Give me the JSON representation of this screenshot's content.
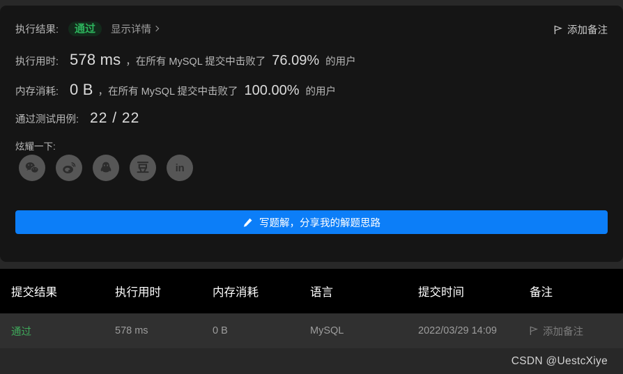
{
  "result_panel": {
    "result_row": {
      "label": "执行结果:",
      "status": "通过",
      "detail_link": "显示详情"
    },
    "add_note_top": {
      "label": "添加备注",
      "icon": "flag-icon"
    },
    "runtime_row": {
      "label": "执行用时:",
      "value": "578 ms",
      "middle": "，在所有 MySQL 提交中击败了",
      "percent": "76.09%",
      "tail": "的用户"
    },
    "memory_row": {
      "label": "内存消耗:",
      "value": "0 B",
      "middle": "，在所有 MySQL 提交中击败了",
      "percent": "100.00%",
      "tail": "的用户"
    },
    "testcases_row": {
      "label": "通过测试用例:",
      "value": "22 / 22"
    },
    "share": {
      "label": "炫耀一下:",
      "icons": [
        {
          "name": "wechat-icon",
          "glyph": ""
        },
        {
          "name": "weibo-icon",
          "glyph": ""
        },
        {
          "name": "qq-icon",
          "glyph": ""
        },
        {
          "name": "douban-icon",
          "glyph": "豆"
        },
        {
          "name": "linkedin-icon",
          "glyph": "in"
        }
      ]
    },
    "cta": {
      "label": "写题解，分享我的解题思路",
      "icon": "pencil-icon",
      "color": "#0c7ef8"
    }
  },
  "submissions_table": {
    "headers": [
      "提交结果",
      "执行用时",
      "内存消耗",
      "语言",
      "提交时间",
      "备注"
    ],
    "rows": [
      {
        "status": "通过",
        "runtime": "578 ms",
        "memory": "0 B",
        "language": "MySQL",
        "submit_time": "2022/03/29 14:09",
        "note": "添加备注"
      }
    ]
  },
  "watermark": "CSDN @UestcXiye",
  "colors": {
    "accent_blue": "#0c7ef8",
    "pass_green": "#2db55d",
    "panel_bg": "#151515",
    "page_bg": "#282828"
  }
}
